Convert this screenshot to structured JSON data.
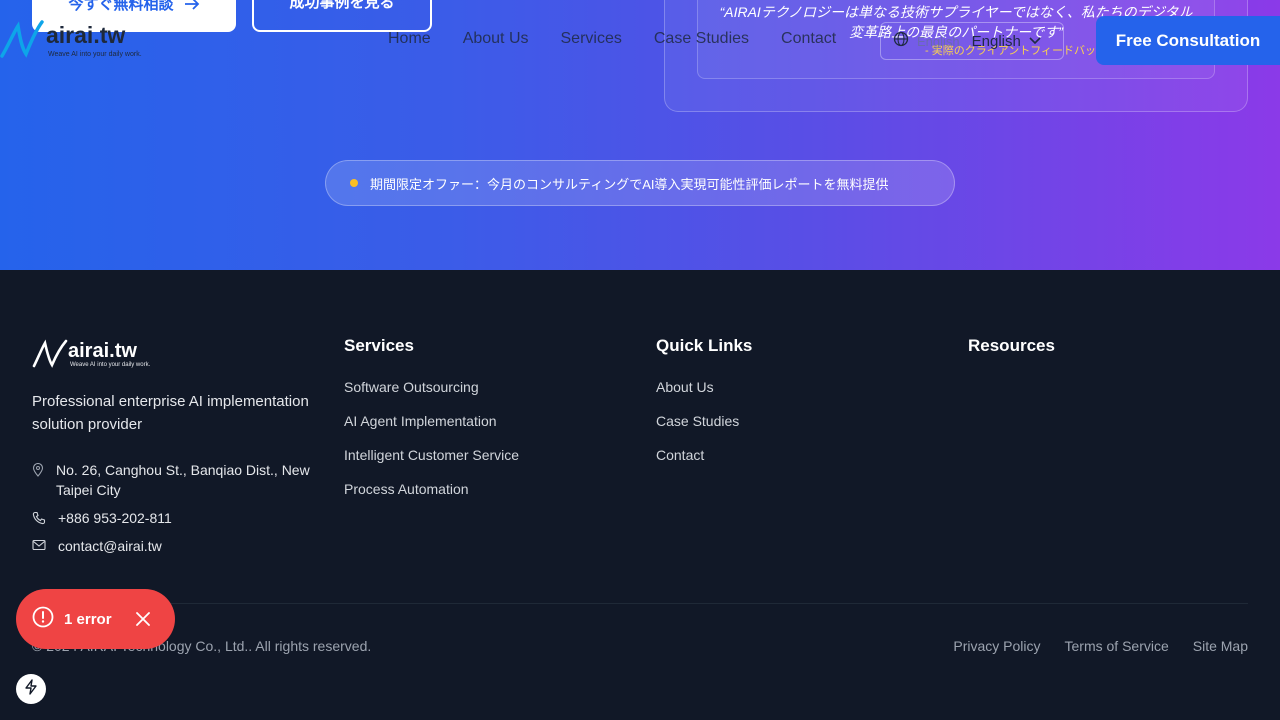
{
  "header": {
    "logo_word": "airai.tw",
    "logo_tagline": "Weave AI into your daily work.",
    "nav": [
      "Home",
      "About Us",
      "Services",
      "Case Studies",
      "Contact"
    ],
    "lang_ghost": "English",
    "lang_label": "English",
    "cta_label": "Free Consultation"
  },
  "hero": {
    "primary_button": "今すぐ無料相談",
    "secondary_button": "成功事例を見る",
    "quote_line1": "“AIRAIテクノロジーは単なる技術サプライヤーではなく、私たちのデジタル",
    "quote_line2": "変革路上の最良のパートナーです”",
    "quote_attribution": "- 実際のクライアントフィードバック",
    "offer_text": "期間限定オファー：今月のコンサルティングでAI導入実現可能性評価レポートを無料提供"
  },
  "footer": {
    "logo_word": "airai.tw",
    "logo_tagline": "Weave AI into your daily work.",
    "description": "Professional enterprise AI implementation solution provider",
    "address": "No. 26, Canghou St., Banqiao Dist., New Taipei City",
    "phone": "+886 953-202-811",
    "email": "contact@airai.tw",
    "columns": {
      "services": {
        "title": "Services",
        "items": [
          "Software Outsourcing",
          "AI Agent Implementation",
          "Intelligent Customer Service",
          "Process Automation"
        ]
      },
      "quick_links": {
        "title": "Quick Links",
        "items": [
          "About Us",
          "Case Studies",
          "Contact"
        ]
      },
      "resources": {
        "title": "Resources"
      }
    },
    "copyright": "© 2024 AIRAI Technology Co., Ltd.. All rights reserved.",
    "legal": [
      "Privacy Policy",
      "Terms of Service",
      "Site Map"
    ]
  },
  "overlay": {
    "error_label": "1 error"
  },
  "colors": {
    "primary": "#2563eb",
    "footer_bg": "#111827",
    "error": "#ef4444",
    "highlight": "#fbbf24"
  }
}
